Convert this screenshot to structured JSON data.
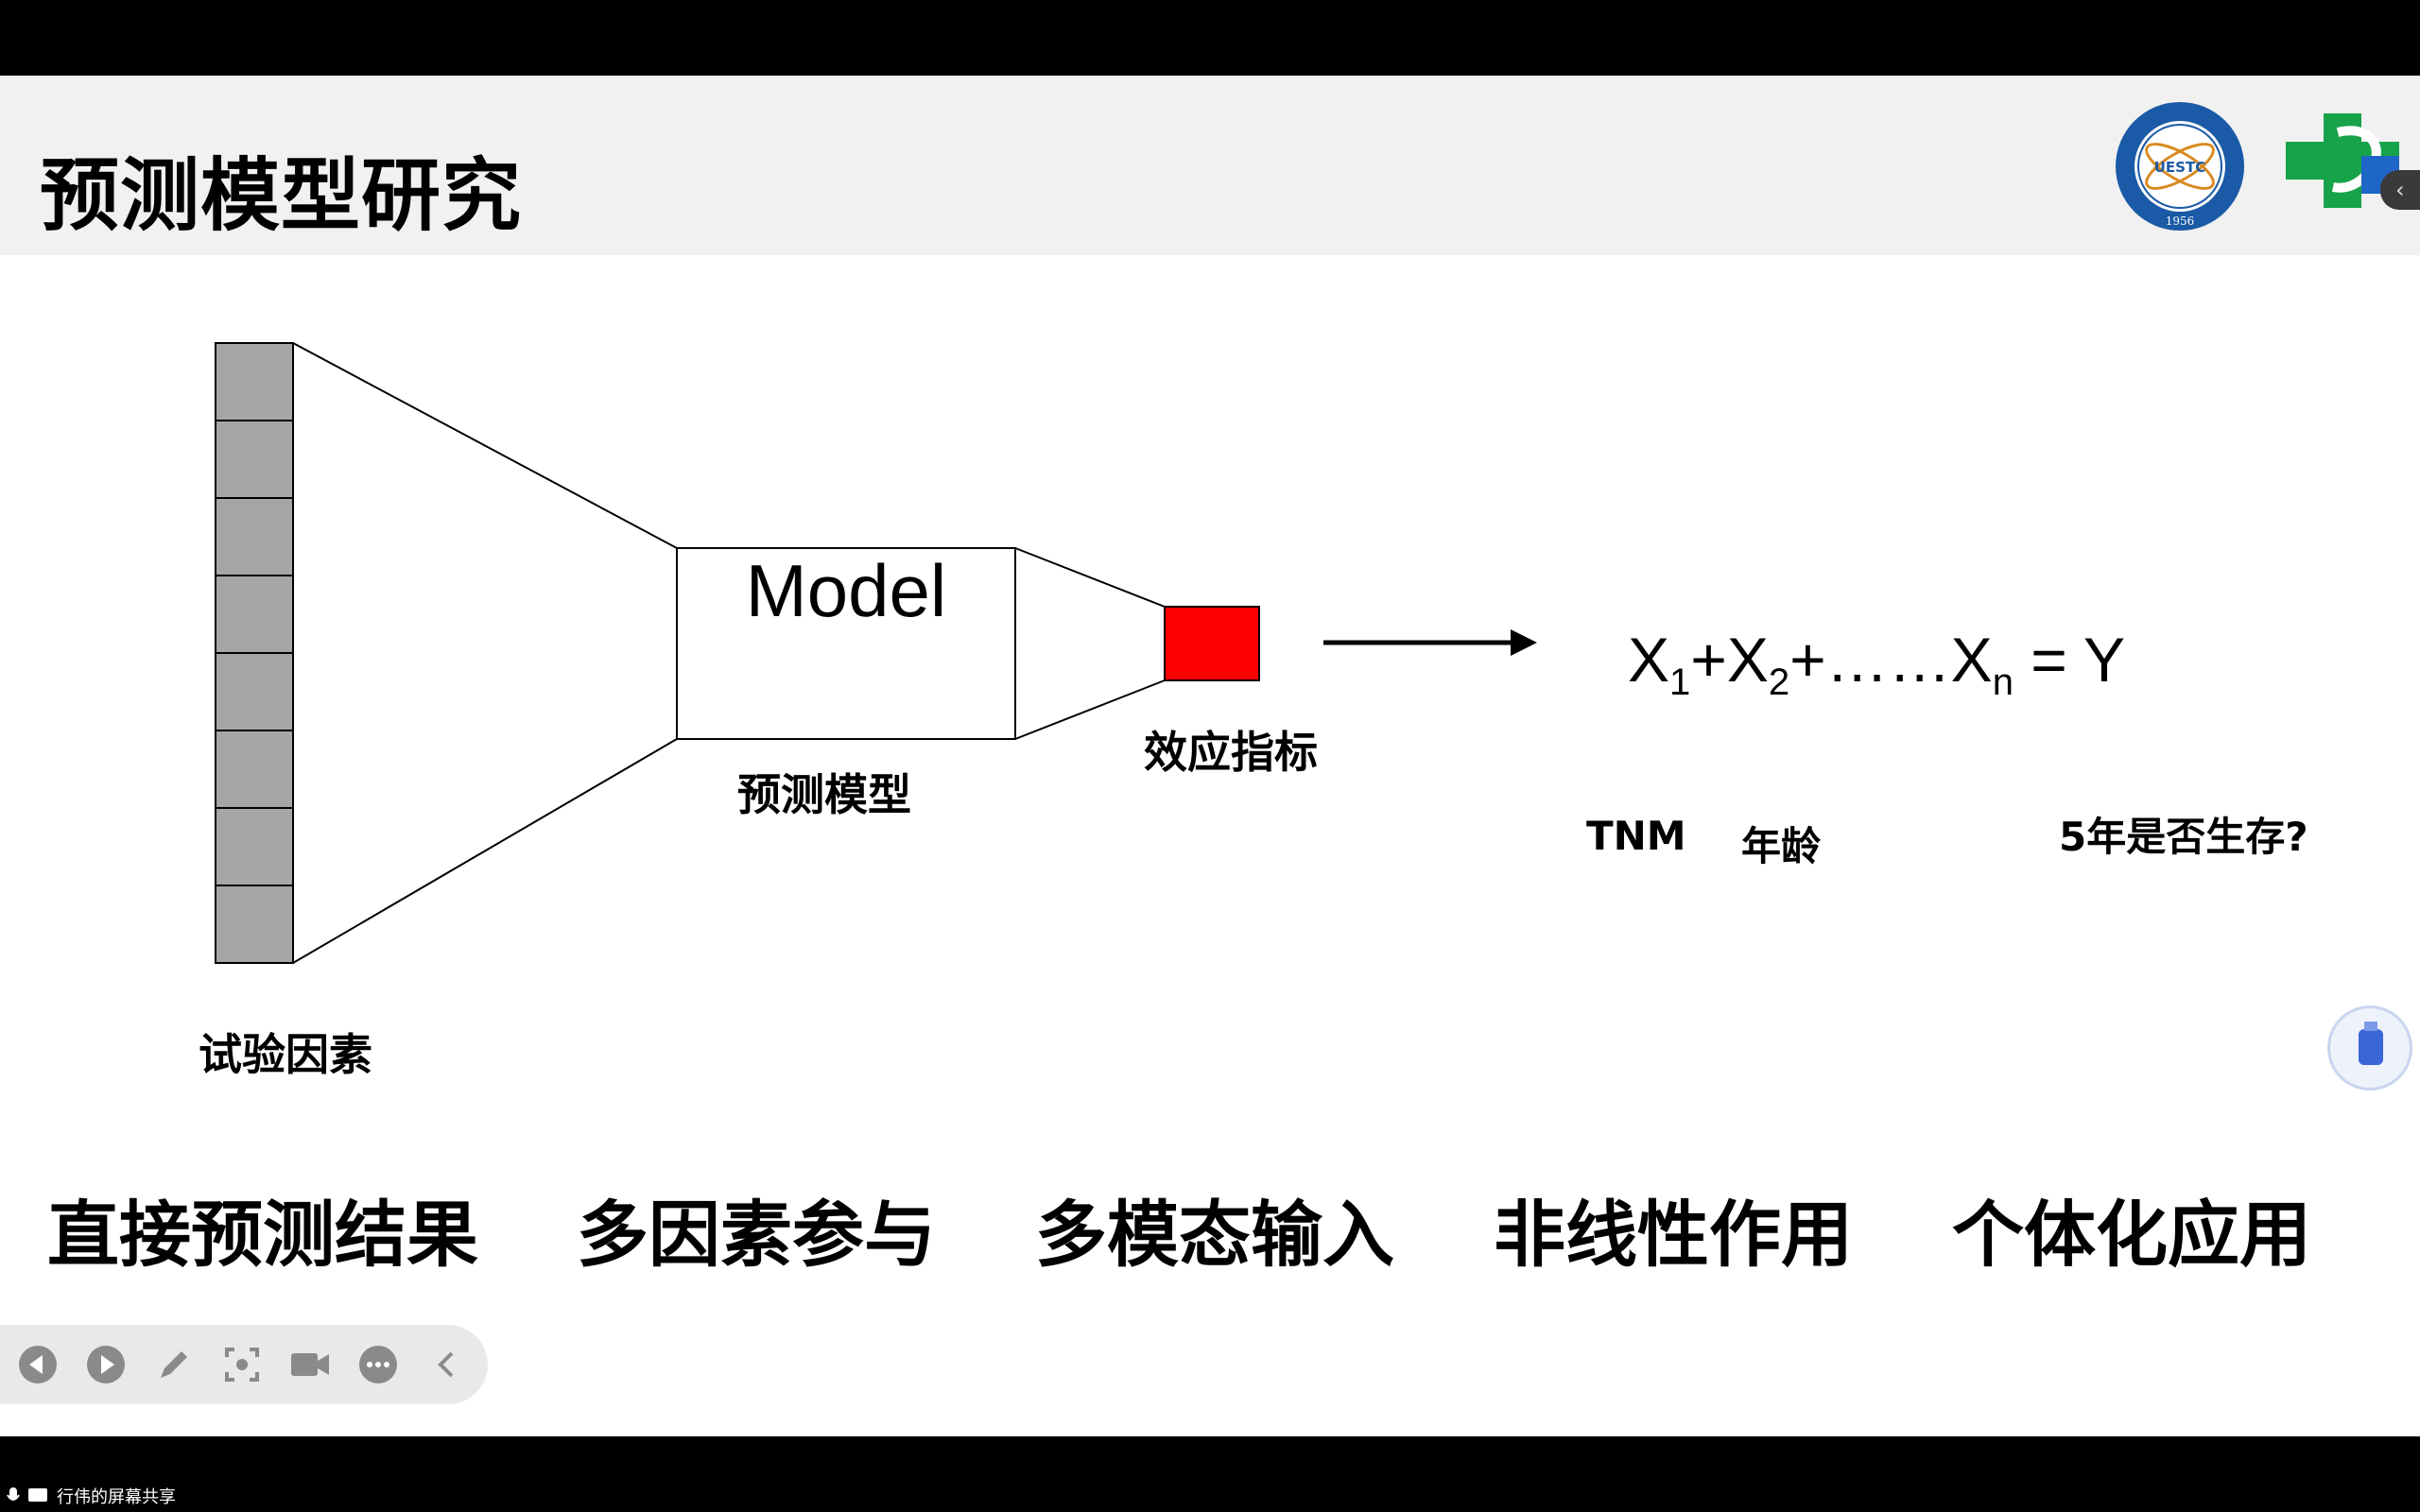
{
  "slide": {
    "title": "预测模型研究"
  },
  "diagram": {
    "input_label": "试验因素",
    "model_text": "Model",
    "model_label": "预测模型",
    "output_label": "效应指标",
    "output_color": "#ff0000",
    "formula": {
      "x1": "X",
      "x1_sub": "1",
      "plus1": "+",
      "x2": "X",
      "x2_sub": "2",
      "plus2": "+……",
      "xn": "X",
      "xn_sub": "n",
      "equals": " = ",
      "y": "Y"
    },
    "variable_labels": {
      "tnm": "TNM",
      "age": "年龄",
      "outcome": "5年是否生存?"
    }
  },
  "features": [
    "直接预测结果",
    "多因素参与",
    "多模态输入",
    "非线性作用",
    "个体化应用"
  ],
  "logos": {
    "uestc_text": "UESTC",
    "uestc_year": "1956",
    "uestc_color": "#1a5aa6",
    "hospital_color_green": "#17a34a",
    "hospital_color_blue": "#1e66c8"
  },
  "toolbar": {
    "icons": [
      "prev-icon",
      "next-icon",
      "pen-icon",
      "screenshot-icon",
      "camera-icon",
      "more-icon",
      "collapse-icon"
    ]
  },
  "screen_share": {
    "label": "行伟的屏幕共享"
  }
}
